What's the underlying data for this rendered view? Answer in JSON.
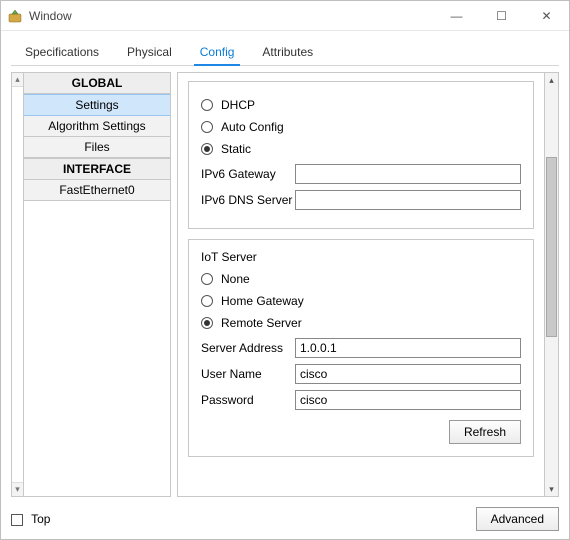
{
  "window": {
    "title": "Window"
  },
  "titlebar_controls": {
    "minimize": "—",
    "maximize": "☐",
    "close": "✕"
  },
  "tabs": {
    "specifications": "Specifications",
    "physical": "Physical",
    "config": "Config",
    "attributes": "Attributes",
    "active": "config"
  },
  "sidebar": {
    "global_header": "GLOBAL",
    "settings": "Settings",
    "algorithm_settings": "Algorithm Settings",
    "files": "Files",
    "interface_header": "INTERFACE",
    "fastethernet0": "FastEthernet0"
  },
  "ip_config": {
    "dhcp": "DHCP",
    "auto_config": "Auto Config",
    "static": "Static",
    "selected": "static",
    "ipv6_gateway_label": "IPv6 Gateway",
    "ipv6_gateway_value": "",
    "ipv6_dns_label": "IPv6 DNS Server",
    "ipv6_dns_value": ""
  },
  "iot": {
    "header": "IoT Server",
    "none": "None",
    "home_gateway": "Home Gateway",
    "remote_server": "Remote Server",
    "selected": "remote_server",
    "server_address_label": "Server Address",
    "server_address_value": "1.0.0.1",
    "user_name_label": "User Name",
    "user_name_value": "cisco",
    "password_label": "Password",
    "password_value": "cisco",
    "refresh_btn": "Refresh"
  },
  "footer": {
    "top_label": "Top",
    "advanced_btn": "Advanced"
  }
}
